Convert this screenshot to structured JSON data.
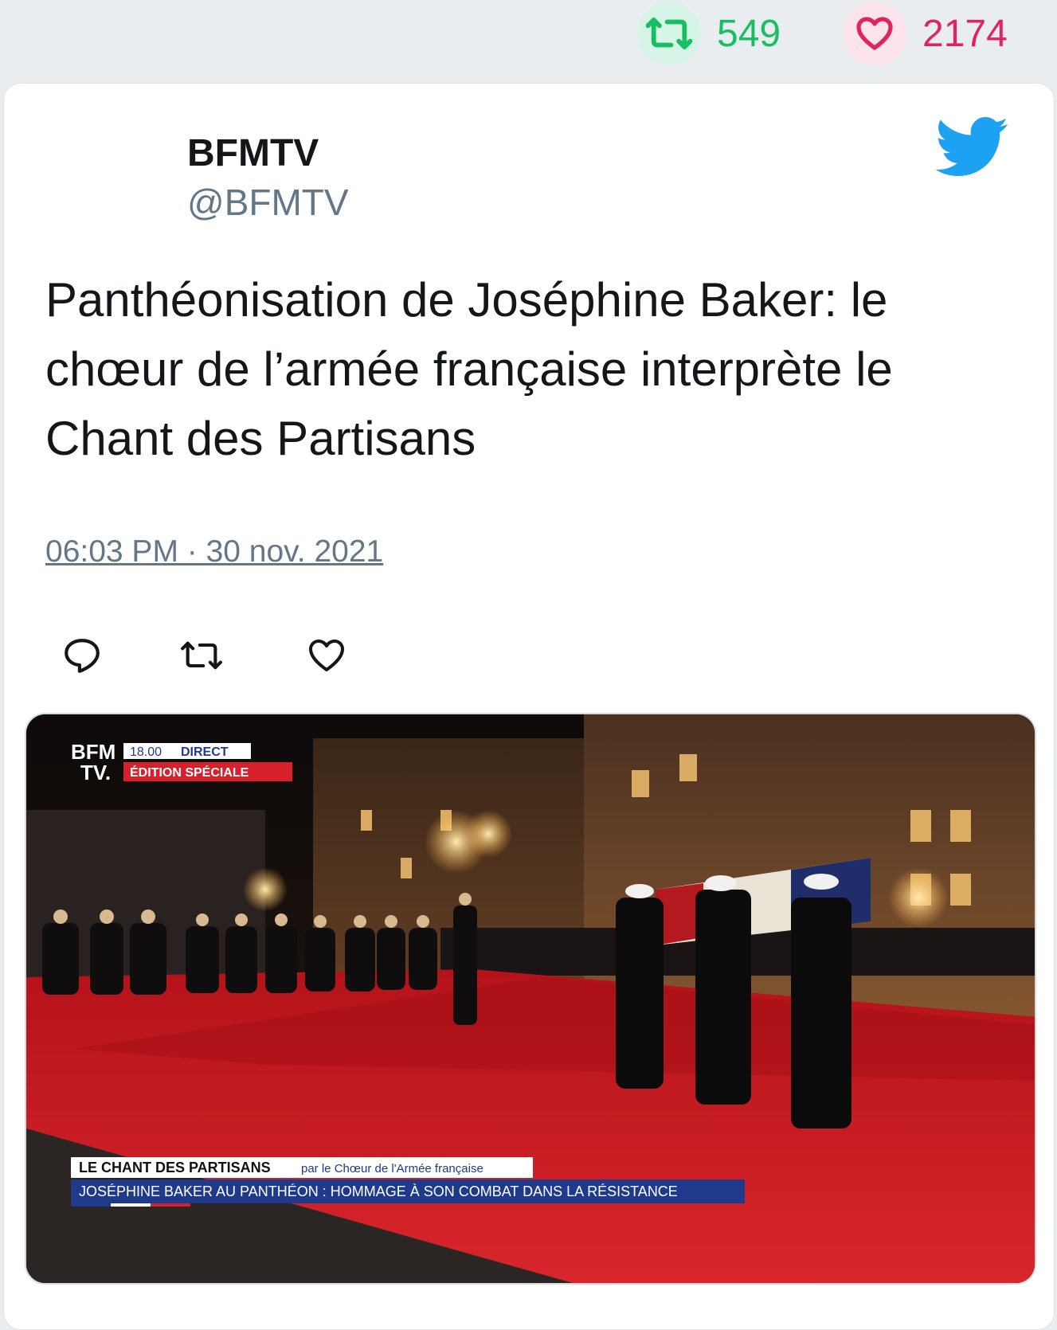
{
  "stats": {
    "retweet_count": "549",
    "like_count": "2174",
    "retweet_icon": "retweet-icon",
    "like_icon": "heart-icon"
  },
  "author": {
    "name": "BFMTV",
    "handle": "@BFMTV"
  },
  "brand_icon": "twitter-bird-icon",
  "tweet": {
    "text": "Panthéonisation de Joséphine Baker: le chœur de l’armée française interprète le Chant des Partisans",
    "timestamp": "06:03 PM · 30 nov. 2021"
  },
  "actions": [
    {
      "icon": "reply-icon"
    },
    {
      "icon": "retweet-icon"
    },
    {
      "icon": "heart-icon"
    }
  ],
  "media": {
    "logo_line1": "BFM",
    "logo_line2": "TV.",
    "time": "18.00",
    "live": "DIRECT",
    "edition": "ÉDITION SPÉCIALE",
    "caption_title": "LE CHANT DES PARTISANS",
    "caption_sub": "par le Chœur de l'Armée française",
    "caption_line2": "JOSÉPHINE BAKER AU PANTHÉON : HOMMAGE À SON COMBAT DANS LA RÉSISTANCE"
  },
  "colors": {
    "retweet_green": "#17bf63",
    "like_red": "#e0245e",
    "twitter_blue": "#1da1f2",
    "text_dark": "#14171a",
    "text_muted": "#657786",
    "carpet_red": "#c8161c",
    "bfm_blue": "#1f3a8a"
  }
}
